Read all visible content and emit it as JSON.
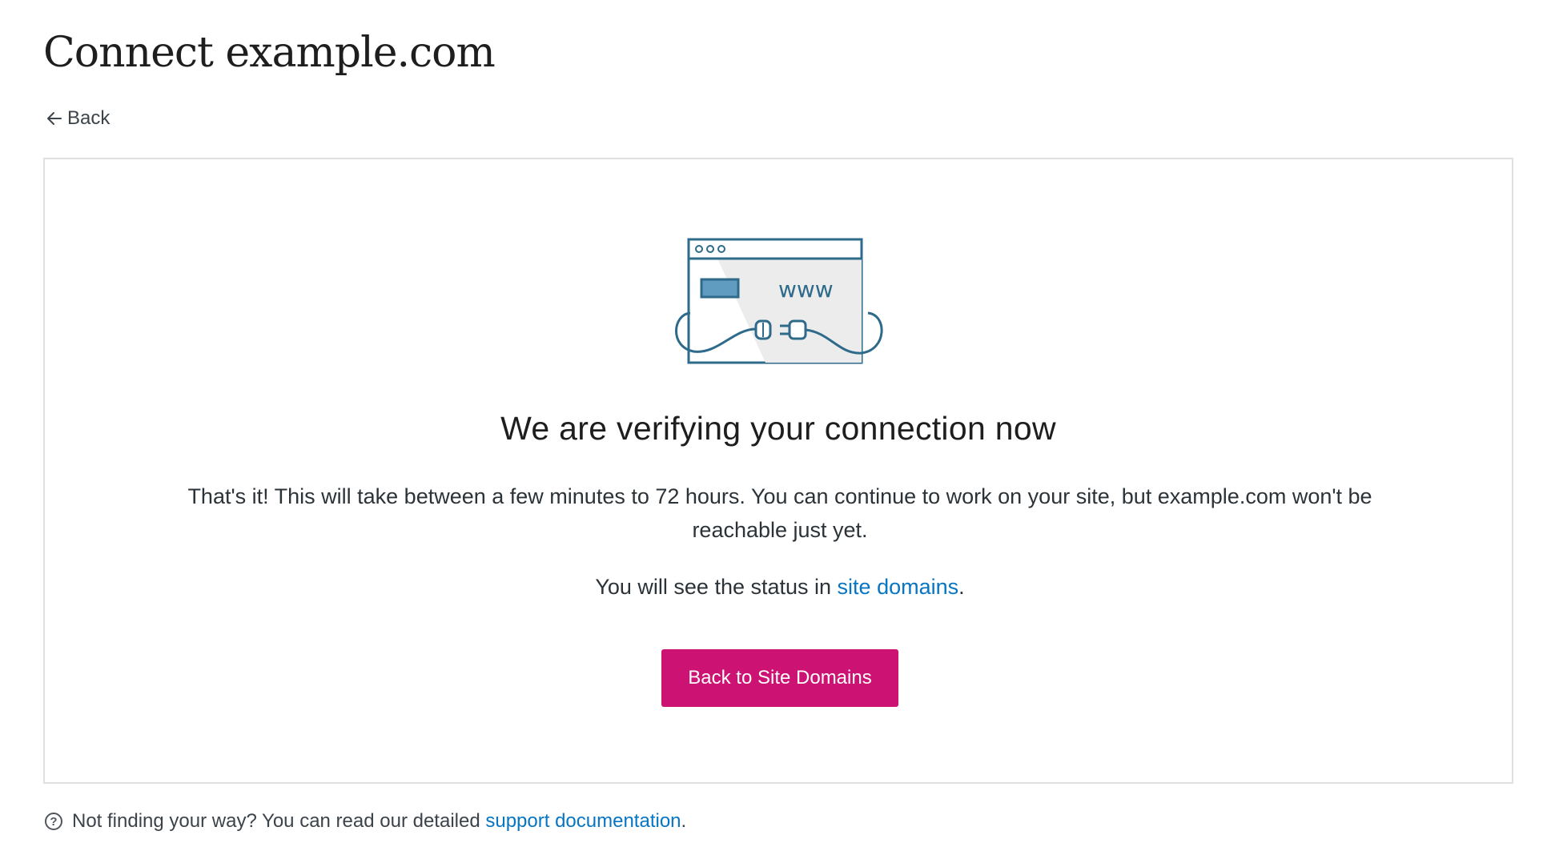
{
  "header": {
    "title": "Connect example.com",
    "back_label": "Back"
  },
  "card": {
    "illustration_text": "www",
    "heading": "We are verifying your connection now",
    "paragraph": "That's it! This will take between a few minutes to 72 hours. You can continue to work on your site, but example.com won't be reachable just yet.",
    "status_prefix": "You will see the status in ",
    "status_link": "site domains",
    "status_suffix": ".",
    "button_label": "Back to Site Domains"
  },
  "help": {
    "icon": "help-circle-icon",
    "prefix": "Not finding your way? You can read our detailed ",
    "link": "support documentation",
    "suffix": "."
  },
  "colors": {
    "primary_button": "#cc1273",
    "link": "#0675c4",
    "illustration_stroke": "#2e6a8a"
  }
}
